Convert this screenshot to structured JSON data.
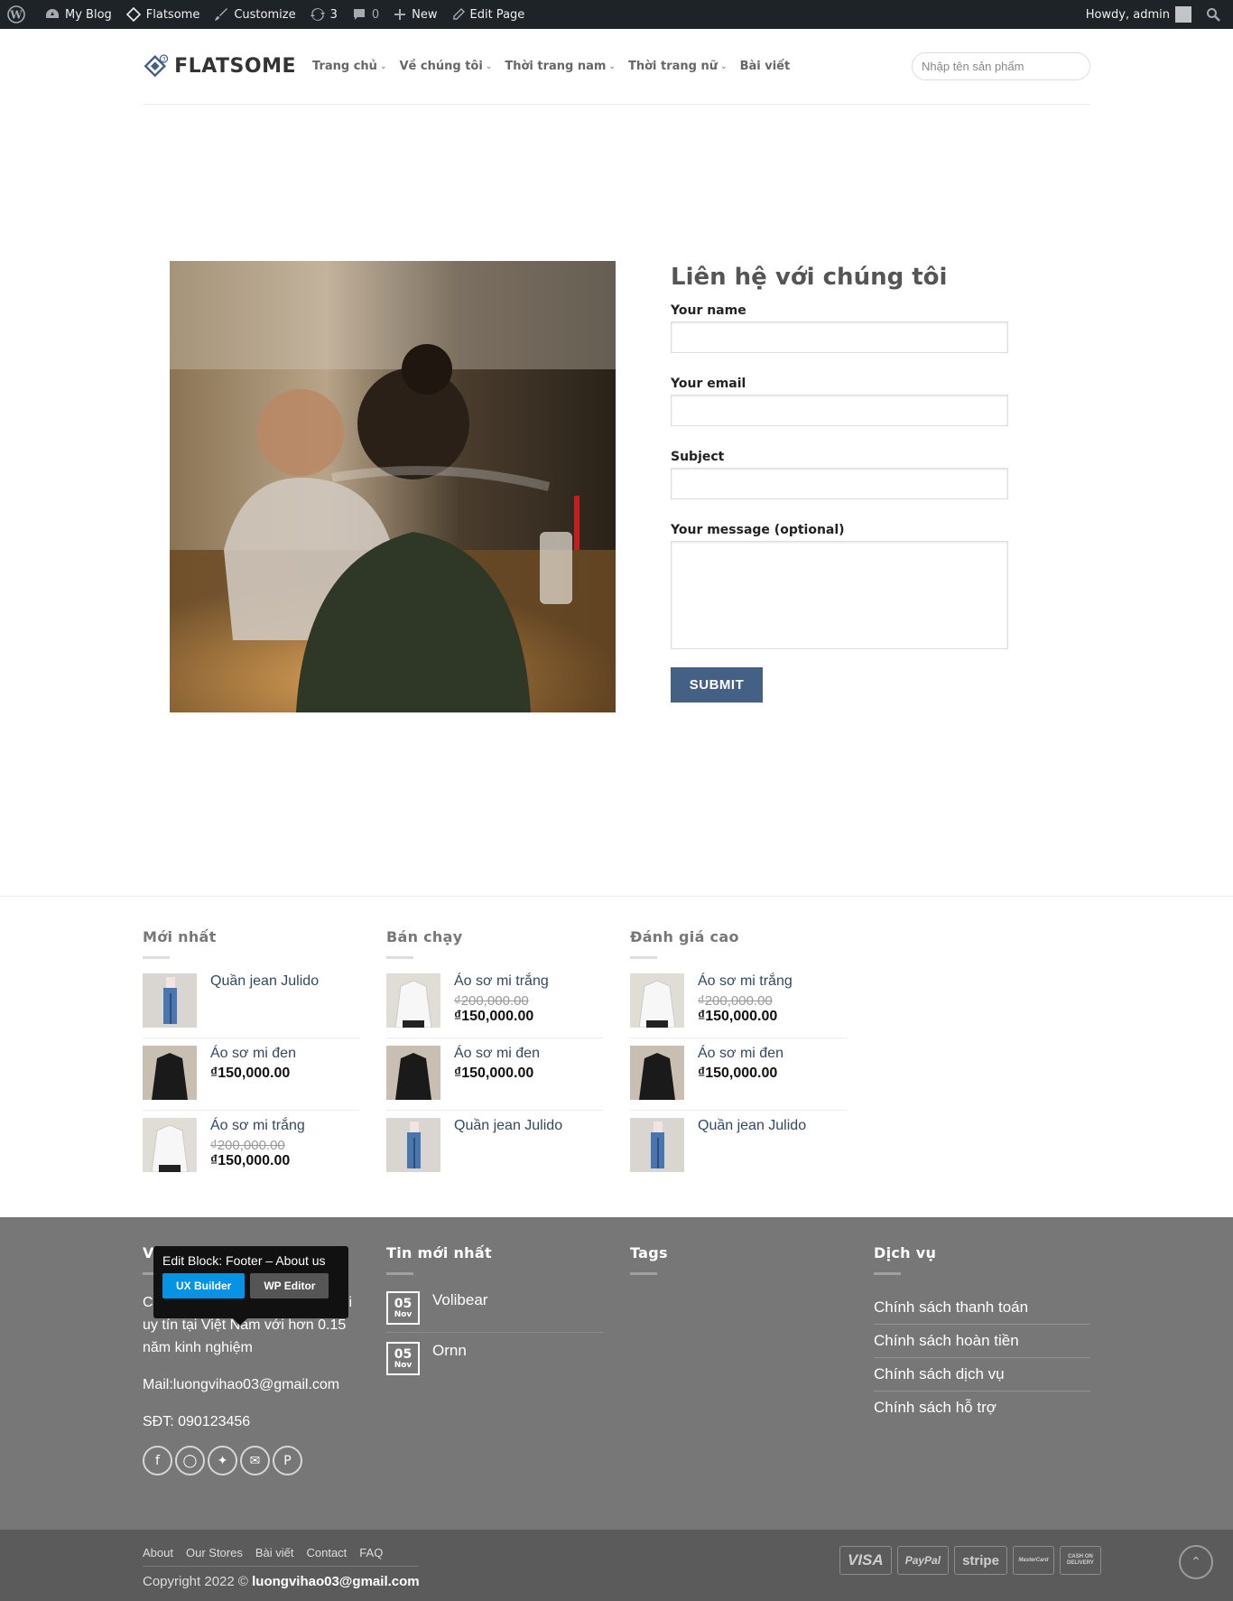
{
  "admin_bar": {
    "site_name": "My Blog",
    "theme_name": "Flatsome",
    "customize": "Customize",
    "updates_count": "3",
    "comments_count": "0",
    "new": "New",
    "edit_page": "Edit Page",
    "howdy": "Howdy, admin"
  },
  "header": {
    "logo_text": "FLATSOME",
    "nav": [
      {
        "label": "Trang chủ",
        "dropdown": true
      },
      {
        "label": "Về chúng tôi",
        "dropdown": true
      },
      {
        "label": "Thời trang nam",
        "dropdown": true
      },
      {
        "label": "Thời trang nữ",
        "dropdown": true
      },
      {
        "label": "Bài viết",
        "dropdown": false
      }
    ],
    "search_placeholder": "Nhập tên sản phẩm"
  },
  "contact": {
    "title": "Liên hệ với chúng tôi",
    "fields": {
      "name_label": "Your name",
      "email_label": "Your email",
      "subject_label": "Subject",
      "message_label": "Your message (optional)"
    },
    "submit_label": "SUBMIT"
  },
  "products": {
    "newest": {
      "title": "Mới nhất",
      "items": [
        {
          "name": "Quần jean Julido"
        },
        {
          "name": "Áo sơ mi đen",
          "price": "₫150,000.00"
        },
        {
          "name": "Áo sơ mi trắng",
          "old_price": "₫200,000.00",
          "price": "₫150,000.00"
        }
      ]
    },
    "best_selling": {
      "title": "Bán chạy",
      "items": [
        {
          "name": "Áo sơ mi trắng",
          "old_price": "₫200,000.00",
          "price": "₫150,000.00"
        },
        {
          "name": "Áo sơ mi đen",
          "price": "₫150,000.00"
        },
        {
          "name": "Quần jean Julido"
        }
      ]
    },
    "top_rated": {
      "title": "Đánh giá cao",
      "items": [
        {
          "name": "Áo sơ mi trắng",
          "old_price": "₫200,000.00",
          "price": "₫150,000.00"
        },
        {
          "name": "Áo sơ mi đen",
          "price": "₫150,000.00"
        },
        {
          "name": "Quần jean Julido"
        }
      ]
    }
  },
  "footer": {
    "about": {
      "title_partial": "V",
      "text_line1_start": "C",
      "text_line1_end": "i",
      "text_rest": "uy tín tại Việt Nam với hơn 0.15 năm kinh nghiệm",
      "mail": "Mail:luongvihao03@gmail.com",
      "phone": "SĐT: 090123456"
    },
    "news": {
      "title": "Tin mới nhất",
      "posts": [
        {
          "day": "05",
          "month": "Nov",
          "title": "Volibear"
        },
        {
          "day": "05",
          "month": "Nov",
          "title": "Ornn"
        }
      ]
    },
    "tags": {
      "title": "Tags"
    },
    "services": {
      "title": "Dịch vụ",
      "items": [
        "Chính sách thanh toán",
        "Chính sách hoàn tiền",
        "Chính sách dịch vụ",
        "Chính sách hỗ trợ"
      ]
    },
    "edit_popup": {
      "title": "Edit Block: Footer – About us",
      "ux_builder": "UX Builder",
      "wp_editor": "WP Editor"
    }
  },
  "bottom": {
    "links": [
      "About",
      "Our Stores",
      "Bài viết",
      "Contact",
      "FAQ"
    ],
    "copyright_prefix": "Copyright 2022 © ",
    "copyright_owner": "luongvihao03@gmail.com",
    "payments": [
      "VISA",
      "PayPal",
      "stripe",
      "MasterCard",
      "CASH ON DELIVERY"
    ]
  },
  "colors": {
    "primary": "#446084",
    "admin_bar": "#1d2327",
    "footer_bg": "#777777",
    "bottom_bg": "#5b5b5b",
    "ux_builder_button": "#0693e3"
  }
}
